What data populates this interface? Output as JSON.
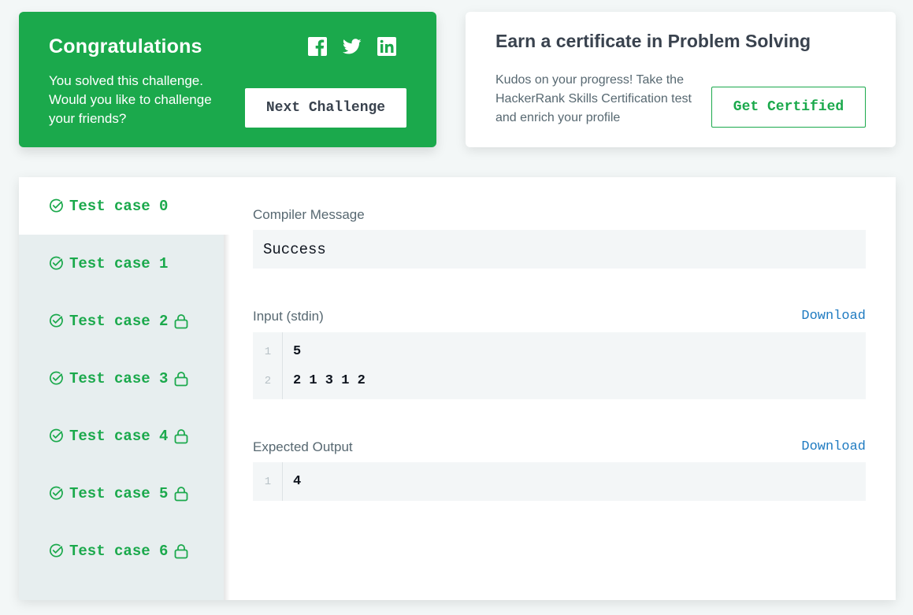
{
  "congrats": {
    "title": "Congratulations",
    "message": "You solved this challenge. Would you like to challenge your friends?",
    "next_button": "Next Challenge",
    "social": [
      "facebook-icon",
      "twitter-icon",
      "linkedin-icon"
    ],
    "bg_color": "#1ba94c"
  },
  "certificate": {
    "title": "Earn a certificate in Problem Solving",
    "message": "Kudos on your progress! Take the HackerRank Skills Certification test and enrich your profile",
    "button": "Get Certified"
  },
  "tests": {
    "active": 0,
    "items": [
      {
        "label": "Test case 0",
        "locked": false,
        "passed": true
      },
      {
        "label": "Test case 1",
        "locked": false,
        "passed": true
      },
      {
        "label": "Test case 2",
        "locked": true,
        "passed": true
      },
      {
        "label": "Test case 3",
        "locked": true,
        "passed": true
      },
      {
        "label": "Test case 4",
        "locked": true,
        "passed": true
      },
      {
        "label": "Test case 5",
        "locked": true,
        "passed": true
      },
      {
        "label": "Test case 6",
        "locked": true,
        "passed": true
      }
    ]
  },
  "result": {
    "compiler_label": "Compiler Message",
    "compiler_message": "Success",
    "input_label": "Input (stdin)",
    "input_download": "Download",
    "input_lines": [
      {
        "n": "1",
        "text": "5"
      },
      {
        "n": "2",
        "text": "2 1 3 1 2"
      }
    ],
    "output_label": "Expected Output",
    "output_download": "Download",
    "output_lines": [
      {
        "n": "1",
        "text": "4"
      }
    ]
  },
  "colors": {
    "accent": "#1ba94c",
    "link": "#1f7bc1",
    "text": "#39424e"
  }
}
